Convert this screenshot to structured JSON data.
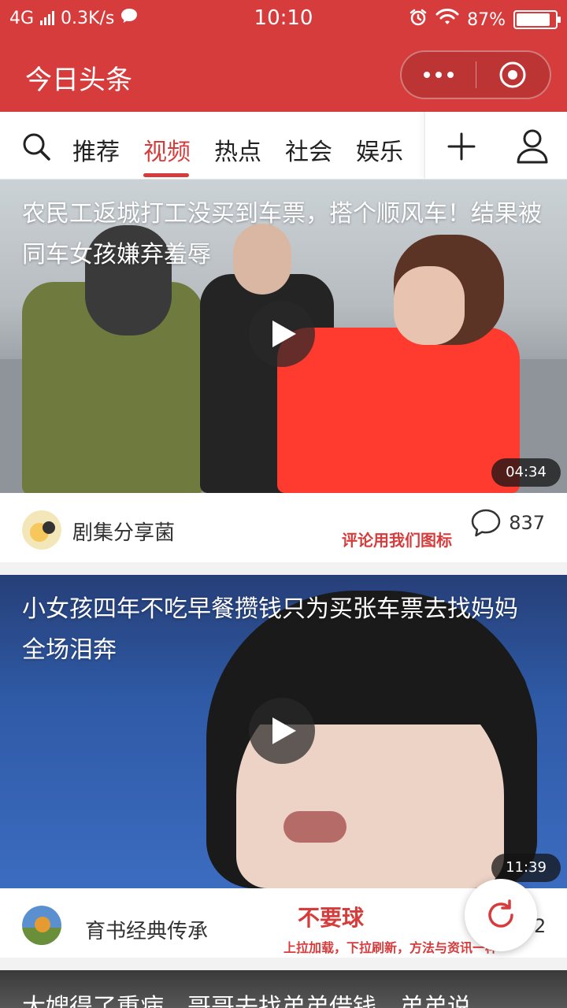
{
  "status": {
    "network": "4G",
    "speed": "0.3K/s",
    "time": "10:10",
    "battery_pct": "87%",
    "battery_level": 0.87
  },
  "header": {
    "title": "今日头条"
  },
  "tabs": {
    "items": [
      "推荐",
      "视频",
      "热点",
      "社会",
      "娱乐"
    ],
    "active_index": 1
  },
  "videos": [
    {
      "title": "农民工返城打工没买到车票，搭个顺风车！结果被同车女孩嫌弃羞辱",
      "duration": "04:34",
      "author": "剧集分享菌",
      "comments": "837",
      "note": "评论用我们图标"
    },
    {
      "title": "小女孩四年不吃早餐攒钱只为买张车票去找妈妈 全场泪奔",
      "duration": "11:39",
      "author": "育书经典传承",
      "comments": "2",
      "note": "不要球",
      "note_sub": "上拉加载，下拉刷新，方法与资讯一样"
    },
    {
      "title": "大嫂得了重病，哥哥去找弟弟借钱，弟弟说"
    }
  ],
  "colors": {
    "brand": "#d63c3c"
  }
}
